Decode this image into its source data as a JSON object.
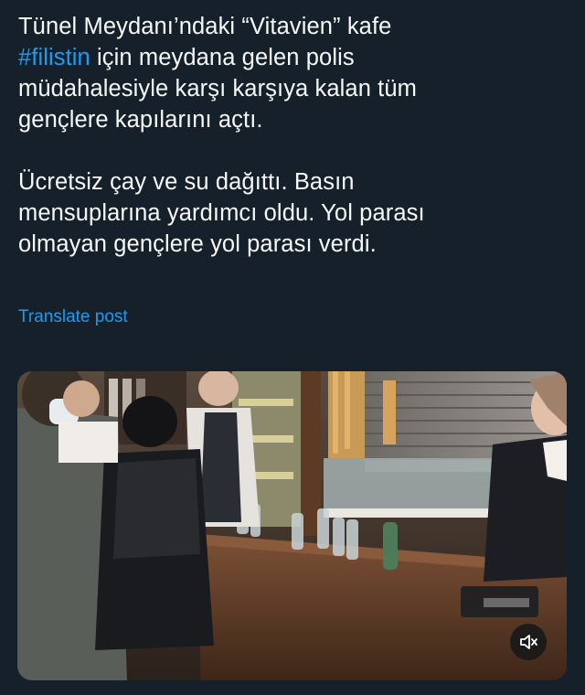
{
  "post": {
    "paragraph1": {
      "line1": "Tünel Meydanı’ndaki “Vitavien” kafe",
      "hashtag": "#filistin",
      "line2_rest": " için meydana gelen polis",
      "line3": "müdahalesiyle karşı karşıya kalan tüm",
      "line4": "gençlere kapılarını açtı."
    },
    "paragraph2": {
      "line1": "Ücretsiz çay ve su dağıttı. Basın",
      "line2": "mensuplarına yardımcı oldu. Yol parası",
      "line3": "olmayan gençlere yol parası verdi."
    },
    "translate_label": "Translate post"
  },
  "media": {
    "type": "video",
    "mute_icon": "speaker-muted-icon"
  },
  "colors": {
    "background": "#15202b",
    "text": "#f7f9f9",
    "link": "#1d9bf0"
  }
}
